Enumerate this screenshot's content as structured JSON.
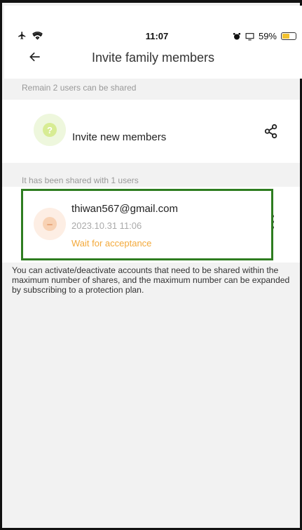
{
  "status_bar": {
    "time": "11:07",
    "battery": "59%",
    "icons": [
      "airplane-icon",
      "wifi-icon",
      "alarm-icon",
      "cast-icon",
      "battery-icon"
    ]
  },
  "header": {
    "title": "Invite family members",
    "back_icon": "arrow-left-icon"
  },
  "remain_label": "Remain 2 users can be shared",
  "invite": {
    "label": "Invite new members",
    "avatar_glyph": "?",
    "share_icon": "share-icon"
  },
  "shared_label": "It has been shared with 1 users",
  "member": {
    "email": "thiwan567@gmail.com",
    "date": "2023.10.31 11:06",
    "status": "Wait for acceptance",
    "status_color": "#f3a93a",
    "menu_icon": "more-vertical-icon"
  },
  "note": "You can activate/deactivate accounts that need to be shared within the maximum number of shares, and the maximum number can be expanded by subscribing to a protection plan.",
  "colors": {
    "highlight": "#2e7d20",
    "background": "#f2f2f2"
  }
}
